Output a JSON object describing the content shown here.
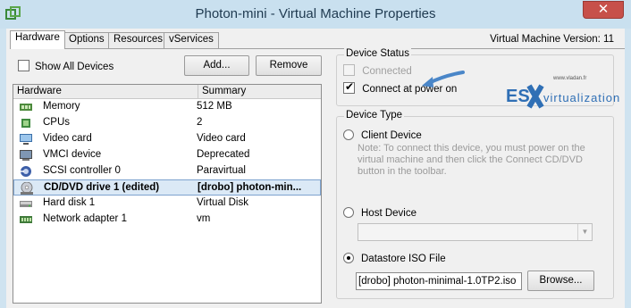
{
  "window": {
    "title": "Photon-mini - Virtual Machine Properties",
    "close_glyph": "✕",
    "app_icon": "vm-properties-icon"
  },
  "tabs": [
    {
      "label": "Hardware",
      "active": true
    },
    {
      "label": "Options",
      "active": false
    },
    {
      "label": "Resources",
      "active": false
    },
    {
      "label": "vServices",
      "active": false
    }
  ],
  "vm_version": "Virtual Machine Version: 11",
  "show_all_devices": {
    "label": "Show All Devices",
    "checked": false
  },
  "buttons": {
    "add": "Add...",
    "remove": "Remove",
    "browse": "Browse..."
  },
  "hardware_list": {
    "columns": [
      "Hardware",
      "Summary"
    ],
    "rows": [
      {
        "name": "Memory",
        "summary": "512 MB",
        "icon": "memory-icon"
      },
      {
        "name": "CPUs",
        "summary": "2",
        "icon": "cpu-icon"
      },
      {
        "name": "Video card",
        "summary": "Video card",
        "icon": "video-card-icon"
      },
      {
        "name": "VMCI device",
        "summary": "Deprecated",
        "icon": "vmci-device-icon"
      },
      {
        "name": "SCSI controller 0",
        "summary": "Paravirtual",
        "icon": "scsi-controller-icon"
      },
      {
        "name": "CD/DVD drive 1 (edited)",
        "summary": "[drobo] photon-min...",
        "icon": "cd-dvd-drive-icon",
        "selected": true
      },
      {
        "name": "Hard disk 1",
        "summary": "Virtual Disk",
        "icon": "hard-disk-icon"
      },
      {
        "name": "Network adapter 1",
        "summary": "vm",
        "icon": "network-adapter-icon"
      }
    ]
  },
  "device_status": {
    "label": "Device Status",
    "connected": {
      "label": "Connected",
      "checked": false,
      "enabled": false
    },
    "connect_at_power_on": {
      "label": "Connect at power on",
      "checked": true
    }
  },
  "device_type": {
    "label": "Device Type",
    "client_device": {
      "label": "Client Device",
      "selected": false
    },
    "client_note": "Note: To connect this device, you must power on the virtual machine and then click the Connect CD/DVD button in the toolbar.",
    "host_device": {
      "label": "Host Device",
      "selected": false,
      "value": ""
    },
    "datastore_iso": {
      "label": "Datastore ISO File",
      "selected": true,
      "value": "[drobo] photon-minimal-1.0TP2.iso"
    }
  },
  "watermark": {
    "brand": "ESX virtualization",
    "url": "www.vladan.fr"
  },
  "colors": {
    "accent": "#2f6fb5",
    "selection": "#dbe9f6",
    "annotation_arrow": "#4a86c8"
  }
}
